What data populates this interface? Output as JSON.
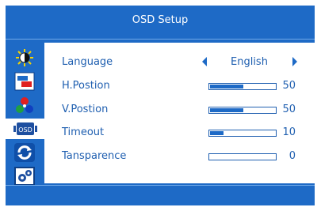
{
  "window": {
    "title": "OSD Setup"
  },
  "sidebar": {
    "items": [
      {
        "icon": "brightness-contrast-icon",
        "selected": false
      },
      {
        "icon": "image-color-icon",
        "selected": false
      },
      {
        "icon": "color-wheel-icon",
        "selected": false
      },
      {
        "icon": "osd-icon",
        "label": "OSD",
        "selected": true
      },
      {
        "icon": "reset-cycle-icon",
        "selected": false
      },
      {
        "icon": "settings-gears-icon",
        "selected": false
      }
    ]
  },
  "settings": {
    "language": {
      "label": "Language",
      "value": "English"
    },
    "h_position": {
      "label": "H.Postion",
      "value": "50",
      "fraction": 0.5
    },
    "v_position": {
      "label": "V.Postion",
      "value": "50",
      "fraction": 0.5
    },
    "timeout": {
      "label": "Timeout",
      "value": "10",
      "fraction": 0.2
    },
    "transparence": {
      "label": "Tansparence",
      "value": "0",
      "fraction": 0.0
    }
  },
  "colors": {
    "accent": "#1e6ac6",
    "text": "#1f5fb0",
    "background": "#ffffff"
  }
}
